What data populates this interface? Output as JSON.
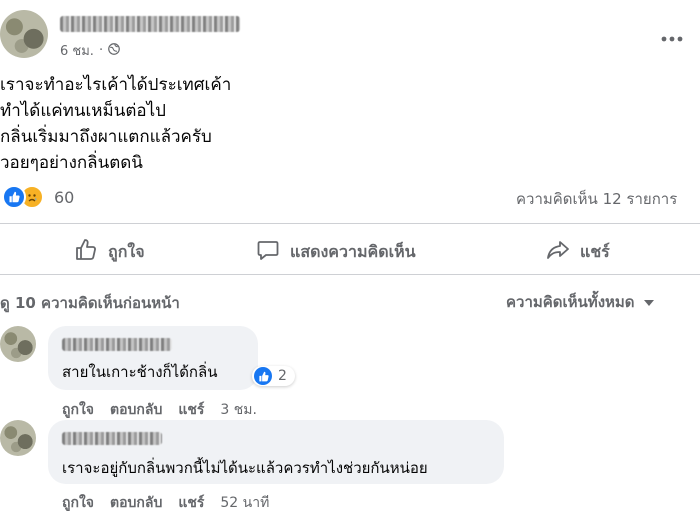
{
  "post": {
    "time": "6 ชม.",
    "privacy_icon": "globe-icon",
    "more_icon": "more-icon",
    "lines": [
      "เราจะทำอะไรเค้าได้ประเทศเค้า",
      "ทำได้แค่ทนเหม็นต่อไป",
      "กลิ่นเริ่มมาถึงผาแตกแล้วครับ",
      "วอยๆอย่างกลิ่นตดนิ"
    ],
    "reaction_count": "60",
    "reaction_icons": [
      "like-icon",
      "sad-icon"
    ],
    "comment_count_label": "ความคิดเห็น 12 รายการ"
  },
  "actions": {
    "like": "ถูกใจ",
    "comment": "แสดงความคิดเห็น",
    "share": "แชร์"
  },
  "comments_header": {
    "previous": "ดู 10 ความคิดเห็นก่อนหน้า",
    "filter": "ความคิดเห็นทั้งหมด"
  },
  "comments": [
    {
      "text": "สายในเกาะช้างก็ได้กลิ่น",
      "reaction_count": "2",
      "like": "ถูกใจ",
      "reply": "ตอบกลับ",
      "share": "แชร์",
      "time": "3 ชม."
    },
    {
      "text": "เราจะอยู่กับกลิ่นพวกนี้ไม่ได้นะแล้วควรทำไงช่วยกันหน่อย",
      "like": "ถูกใจ",
      "reply": "ตอบกลับ",
      "share": "แชร์",
      "time": "52 นาที"
    }
  ],
  "colors": {
    "like_blue": "#1877f2",
    "sad_yellow": "#f7b125",
    "muted": "#65676b",
    "bubble": "#f0f2f5",
    "divider": "#ced0d4"
  }
}
